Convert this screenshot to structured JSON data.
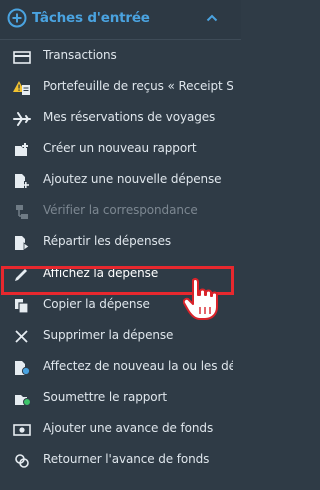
{
  "header": {
    "title": "Tâches d'entrée",
    "plus_icon": "plus-circle-icon",
    "chevron_icon": "chevron-up-icon"
  },
  "colors": {
    "background": "#2f3b46",
    "accent": "#4aa3e0",
    "highlight": "#e8282e",
    "warning": "#f2c230",
    "success": "#3ec46b"
  },
  "menu": {
    "items": [
      {
        "label": "Transactions",
        "icon": "credit-card-icon"
      },
      {
        "label": "Portefeuille de reçus « Receipt Store »",
        "icon": "receipt-warning-icon"
      },
      {
        "label": "Mes réservations de voyages",
        "icon": "airplane-icon"
      },
      {
        "label": "Créer un nouveau rapport",
        "icon": "new-report-icon"
      },
      {
        "label": "Ajoutez une nouvelle dépense",
        "icon": "add-expense-icon"
      },
      {
        "label": "Vérifier la correspondance",
        "icon": "match-icon"
      },
      {
        "label": "Répartir les dépenses",
        "icon": "allocate-icon"
      },
      {
        "label": "Affichez la dépense",
        "icon": "pencil-icon"
      },
      {
        "label": "Copier la dépense",
        "icon": "copy-icon"
      },
      {
        "label": "Supprimer la dépense",
        "icon": "x-icon"
      },
      {
        "label": "Affectez de nouveau la ou les dépenses",
        "icon": "reassign-icon"
      },
      {
        "label": "Soumettre le rapport",
        "icon": "submit-icon"
      },
      {
        "label": "Ajouter une avance de fonds",
        "icon": "cash-icon"
      },
      {
        "label": "Retourner l'avance de fonds",
        "icon": "return-cash-icon"
      }
    ]
  }
}
